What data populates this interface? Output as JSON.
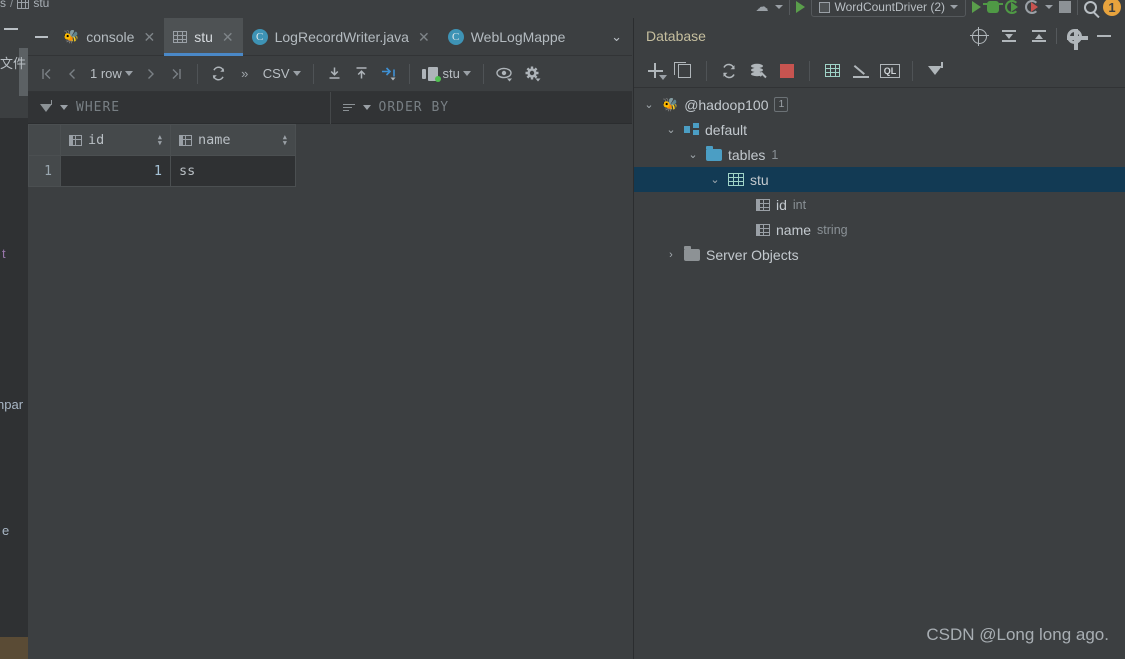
{
  "top_toolbar": {
    "breadcrumb_fragment": "s",
    "breadcrumb_sep": "/",
    "breadcrumb_last": "stu",
    "run_config": "WordCountDriver (2)",
    "icons": {
      "cloud": "cloud-icon",
      "run": "run-icon",
      "debug": "debug-icon",
      "coverage": "run-with-coverage-icon",
      "profile": "profile-icon",
      "stop": "stop-icon",
      "search": "search-icon",
      "notifications": "1"
    }
  },
  "left_sliver": {
    "fragment_files": "文件",
    "fragment_t": "t",
    "fragment_npar": "npar",
    "fragment_e": "e"
  },
  "tabs": {
    "hide_label": "hide-tool-window",
    "items": [
      {
        "label": "console",
        "icon": "hive-bee-icon",
        "active": false,
        "closable": true
      },
      {
        "label": "stu",
        "icon": "table-icon",
        "active": true,
        "closable": true
      },
      {
        "label": "LogRecordWriter.java",
        "icon": "java-class-icon",
        "active": false,
        "closable": true
      },
      {
        "label": "WebLogMappe",
        "icon": "java-class-icon",
        "active": false,
        "closable": false
      }
    ],
    "overflow_label": "⌄"
  },
  "grid_toolbar": {
    "first_page": "|<",
    "prev_page": "<",
    "row_count": "1 row",
    "next_page": ">",
    "last_page": ">|",
    "reload": "reload-icon",
    "more": "»",
    "format": "CSV",
    "export_down": "export-to-file-icon",
    "import_up": "import-icon",
    "modify": "submit-icon",
    "session": "stu",
    "view_options": "view-options-icon",
    "settings": "settings-icon"
  },
  "filter_bar": {
    "where_label": "WHERE",
    "order_by_label": "ORDER BY"
  },
  "data_grid": {
    "columns": [
      "id",
      "name"
    ],
    "column_types": [
      "int",
      "string"
    ],
    "rows": [
      {
        "num": "1",
        "id": "1",
        "name": "ss"
      }
    ]
  },
  "database_panel": {
    "title": "Database",
    "header_buttons": [
      "locate-icon",
      "expand-all-icon",
      "collapse-all-icon",
      "gear-icon",
      "hide-icon"
    ],
    "toolbar_buttons": [
      "add-icon",
      "copy-icon",
      "refresh-icon",
      "data-source-properties-icon",
      "stop-icon",
      "open-table-editor-icon",
      "modify-icon",
      "open-console-icon",
      "filter-icon"
    ],
    "ql_label": "QL",
    "tree": [
      {
        "depth": 0,
        "twisty": "⌄",
        "icon": "hive-data-source-icon",
        "label": "@hadoop100",
        "badge": "1",
        "sub": "",
        "selected": false
      },
      {
        "depth": 1,
        "twisty": "⌄",
        "icon": "schema-icon",
        "label": "default",
        "badge": "",
        "sub": "",
        "selected": false
      },
      {
        "depth": 2,
        "twisty": "⌄",
        "icon": "folder-icon",
        "label": "tables",
        "badge": "",
        "sub": "1",
        "selected": false
      },
      {
        "depth": 3,
        "twisty": "⌄",
        "icon": "table-icon",
        "label": "stu",
        "badge": "",
        "sub": "",
        "selected": true
      },
      {
        "depth": 4,
        "twisty": "",
        "icon": "column-icon",
        "label": "id",
        "badge": "",
        "sub": "int",
        "selected": false
      },
      {
        "depth": 4,
        "twisty": "",
        "icon": "column-icon",
        "label": "name",
        "badge": "",
        "sub": "string",
        "selected": false
      },
      {
        "depth": 1,
        "twisty": "›",
        "icon": "folder-gray-icon",
        "label": "Server Objects",
        "badge": "",
        "sub": "",
        "selected": false
      }
    ]
  },
  "watermark": {
    "text": "CSDN @Long long ago."
  },
  "colors": {
    "background": "#3c3f41",
    "panel_dark": "#2f3133",
    "accent_blue": "#4a88c7",
    "selection": "#123a54",
    "title_gold": "#c6bf9f",
    "stop_red": "#c75450",
    "table_teal": "#9fd3c7",
    "folder_blue": "#4b9ec4"
  }
}
